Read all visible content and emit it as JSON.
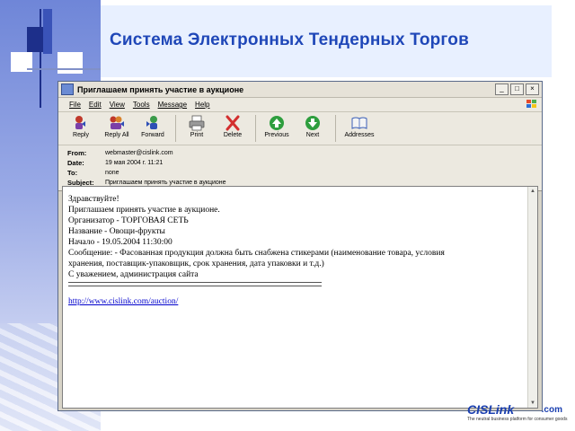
{
  "slide": {
    "title": "Система Электронных Тендерных Торгов"
  },
  "window": {
    "title": "Приглашаем принять участие в аукционе",
    "controls": [
      "_",
      "□",
      "×"
    ]
  },
  "menu": [
    "File",
    "Edit",
    "View",
    "Tools",
    "Message",
    "Help"
  ],
  "toolbar": {
    "reply": "Reply",
    "reply_all": "Reply All",
    "forward": "Forward",
    "print": "Print",
    "delete": "Delete",
    "previous": "Previous",
    "next": "Next",
    "addresses": "Addresses"
  },
  "headers": {
    "from_label": "From:",
    "from": "webmaster@cislink.com",
    "date_label": "Date:",
    "date": "19 мая 2004 г. 11:21",
    "to_label": "To:",
    "to": "none",
    "subject_label": "Subject:",
    "subject": "Приглашаем принять участие в аукционе"
  },
  "body": {
    "line1": "Здравствуйте!",
    "line2": "Приглашаем принять участие в аукционе.",
    "line3": "Организатор - ТОРГОВАЯ СЕТЬ",
    "line4": "Название - Овощи-фрукты",
    "line5": "Начало - 19.05.2004 11:30:00",
    "line6": "Сообщение: - Фасованная продукция должна быть снабжена стикерами (наименование товара, условия",
    "line7": "хранения, поставщик-упаковщик, срок хранения, дата упаковки и т.д.)",
    "line8": "С уважением, администрация сайта",
    "link": "http://www.cislink.com/auction/"
  },
  "footer": {
    "logo_brand": "CISLink",
    "logo_com": ".com",
    "tagline": "The neutral business platform for consumer goods"
  },
  "colors": {
    "title": "#1f47b8",
    "link": "#0000cc",
    "window_chrome": "#ece9e0"
  }
}
